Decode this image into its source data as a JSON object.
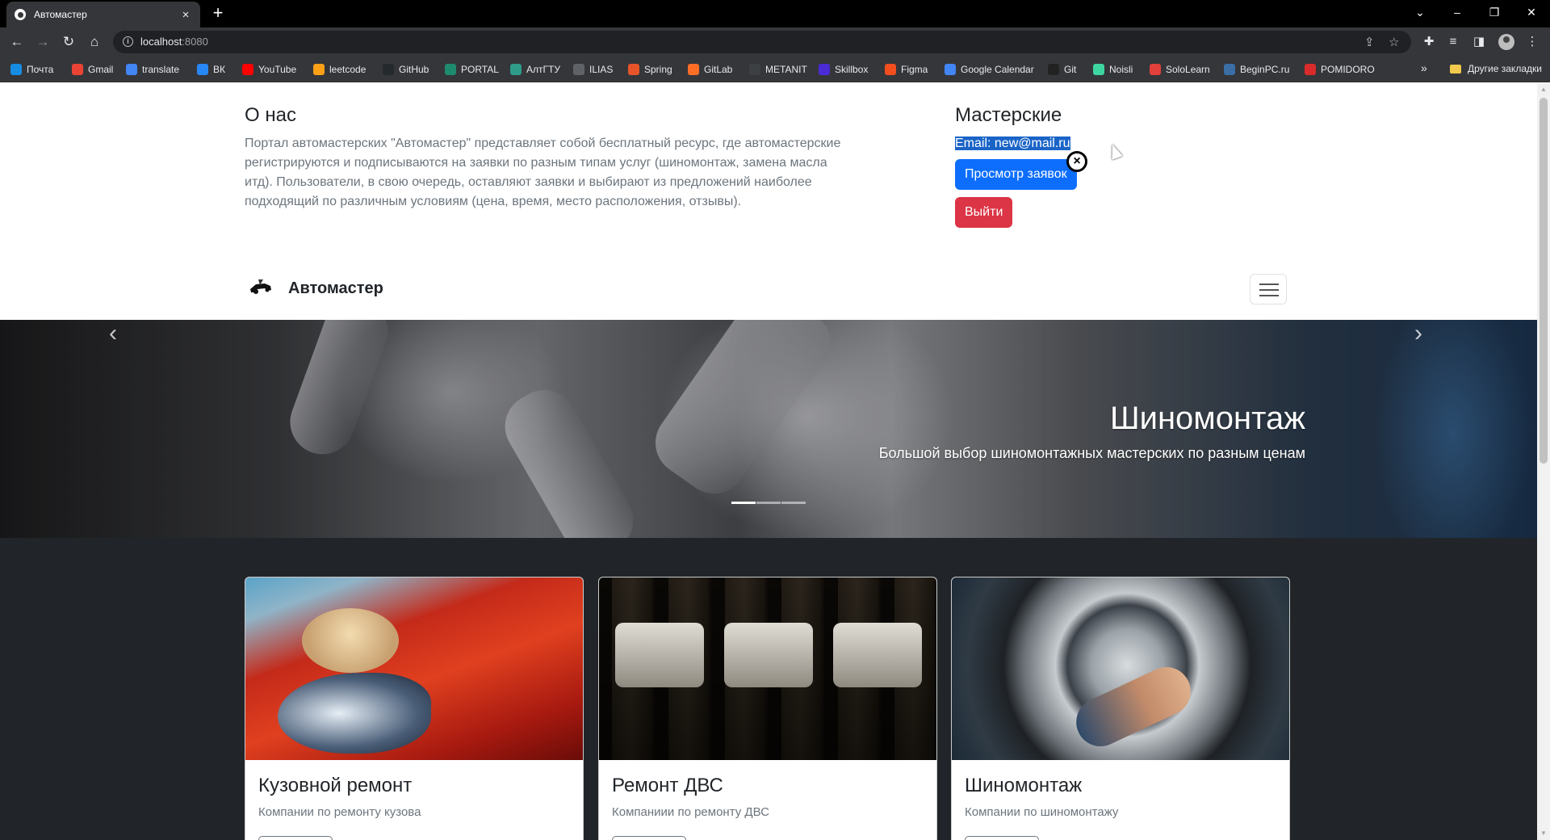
{
  "browser": {
    "tab_title": "Автомастер",
    "tab_close": "×",
    "new_tab": "+",
    "url_host": "localhost",
    "url_port": ":8080",
    "window_controls": [
      "⌄",
      "–",
      "❐",
      "✕"
    ],
    "bookmarks": [
      {
        "label": "Почта",
        "icon": "mail-ru-icon",
        "color": "#168de2"
      },
      {
        "label": "Gmail",
        "icon": "gmail-icon",
        "color": "#ea4335"
      },
      {
        "label": "translate",
        "icon": "google-translate-icon",
        "color": "#4285f4"
      },
      {
        "label": "ВК",
        "icon": "vk-icon",
        "color": "#2787f5"
      },
      {
        "label": "YouTube",
        "icon": "youtube-icon",
        "color": "#ff0000"
      },
      {
        "label": "leetcode",
        "icon": "leetcode-icon",
        "color": "#ffa116"
      },
      {
        "label": "GitHub",
        "icon": "github-icon",
        "color": "#24292e"
      },
      {
        "label": "PORTAL",
        "icon": "portal-icon",
        "color": "#1e8a6e"
      },
      {
        "label": "АлтГТУ",
        "icon": "altgtu-icon",
        "color": "#2f9c8a"
      },
      {
        "label": "ILIAS",
        "icon": "ilias-icon",
        "color": "#5f6368"
      },
      {
        "label": "Spring",
        "icon": "spring-icon",
        "color": "#e8542a"
      },
      {
        "label": "GitLab",
        "icon": "gitlab-icon",
        "color": "#fc6d26"
      },
      {
        "label": "METANIT",
        "icon": "metanit-icon",
        "color": "#3c4043"
      },
      {
        "label": "Skillbox",
        "icon": "skillbox-icon",
        "color": "#4b2bd6"
      },
      {
        "label": "Figma",
        "icon": "figma-icon",
        "color": "#f24e1e"
      },
      {
        "label": "Google Calendar",
        "icon": "google-icon",
        "color": "#4285f4"
      },
      {
        "label": "Git",
        "icon": "git-icon",
        "color": "#222222"
      },
      {
        "label": "Noisli",
        "icon": "noisli-icon",
        "color": "#3ed6a0"
      },
      {
        "label": "SoloLearn",
        "icon": "sololearn-icon",
        "color": "#e2403b"
      },
      {
        "label": "BeginPC.ru",
        "icon": "beginpc-icon",
        "color": "#3a6ea5"
      },
      {
        "label": "POMIDORO",
        "icon": "pomidoro-icon",
        "color": "#d92b2b"
      }
    ],
    "bookmarks_more": "»",
    "other_bookmarks": "Другие закладки"
  },
  "about": {
    "title": "О нас",
    "text": "Портал автомастерских \"Автомастер\" представляет собой бесплатный ресурс, где автомастерские регистрируются и подписываются на заявки по разным типам услуг (шиномонтаж, замена масла итд). Пользователи, в свою очередь, оставляют заявки и выбирают из предложений наиболее подходящий по различным условиям (цена, время, место расположения, отзывы)."
  },
  "shops": {
    "title": "Мастерские",
    "email": "Email: new@mail.ru",
    "view_button": "Просмотр заявок",
    "logout_button": "Выйти"
  },
  "navbar": {
    "brand": "Автомастер"
  },
  "carousel": {
    "title": "Шиномонтаж",
    "subtitle": "Большой выбор шиномонтажных мастерских по разным ценам",
    "prev": "‹",
    "next": "›"
  },
  "cards": [
    {
      "title": "Кузовной ремонт",
      "text": "Компании по ремонту кузова"
    },
    {
      "title": "Ремонт ДВС",
      "text": "Компаниии по ремонту ДВС"
    },
    {
      "title": "Шиномонтаж",
      "text": "Компании по шиномонтажу"
    }
  ],
  "colors": {
    "primary": "#0d6efd",
    "danger": "#dc3545",
    "dark": "#212529",
    "muted": "#6c757d"
  }
}
